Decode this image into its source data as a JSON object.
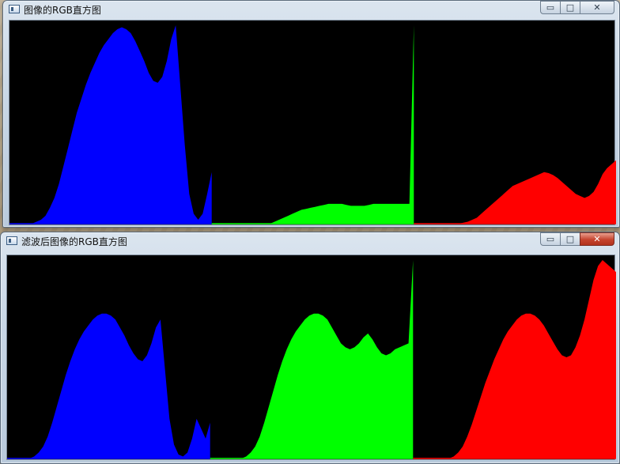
{
  "windows": [
    {
      "title": "图像的RGB直方图",
      "buttons": {
        "minimize": "▭",
        "maximize": "□",
        "close": "✕"
      }
    },
    {
      "title": "滤波后图像的RGB直方图",
      "buttons": {
        "minimize": "▭",
        "maximize": "□",
        "close": "✕"
      }
    }
  ],
  "colors": {
    "blue": "#0000ff",
    "green": "#00ff00",
    "red": "#ff0000",
    "background": "#000000"
  },
  "chart_data": [
    {
      "type": "area",
      "title": "",
      "series": [
        {
          "color": "#0000ff",
          "values": [
            0,
            0,
            0,
            0,
            0,
            0,
            0.01,
            0.02,
            0.04,
            0.08,
            0.13,
            0.2,
            0.29,
            0.38,
            0.47,
            0.56,
            0.63,
            0.7,
            0.76,
            0.81,
            0.86,
            0.9,
            0.93,
            0.96,
            0.98,
            0.99,
            0.98,
            0.96,
            0.92,
            0.87,
            0.82,
            0.76,
            0.72,
            0.71,
            0.74,
            0.82,
            0.93,
            1.0,
            0.7,
            0.4,
            0.15,
            0.05,
            0.02,
            0.05,
            0.15,
            0.26
          ]
        },
        {
          "color": "#00ff00",
          "values": [
            0,
            0,
            0,
            0,
            0,
            0,
            0,
            0,
            0,
            0,
            0,
            0,
            0,
            0,
            0.01,
            0.02,
            0.03,
            0.04,
            0.05,
            0.06,
            0.07,
            0.075,
            0.08,
            0.085,
            0.09,
            0.095,
            0.1,
            0.1,
            0.1,
            0.1,
            0.095,
            0.09,
            0.09,
            0.09,
            0.09,
            0.095,
            0.1,
            0.1,
            0.1,
            0.1,
            0.1,
            0.1,
            0.1,
            0.1,
            0.1,
            1.0
          ]
        },
        {
          "color": "#ff0000",
          "values": [
            0,
            0,
            0,
            0,
            0,
            0,
            0,
            0,
            0,
            0,
            0,
            0.005,
            0.01,
            0.02,
            0.03,
            0.05,
            0.07,
            0.09,
            0.11,
            0.13,
            0.15,
            0.17,
            0.19,
            0.2,
            0.21,
            0.22,
            0.23,
            0.24,
            0.25,
            0.26,
            0.255,
            0.245,
            0.23,
            0.21,
            0.19,
            0.17,
            0.15,
            0.14,
            0.13,
            0.14,
            0.16,
            0.2,
            0.25,
            0.28,
            0.3,
            0.32
          ]
        }
      ]
    },
    {
      "type": "area",
      "title": "",
      "series": [
        {
          "color": "#0000ff",
          "values": [
            0,
            0,
            0,
            0,
            0,
            0,
            0.01,
            0.03,
            0.06,
            0.11,
            0.18,
            0.26,
            0.34,
            0.42,
            0.49,
            0.55,
            0.6,
            0.64,
            0.67,
            0.7,
            0.72,
            0.73,
            0.73,
            0.72,
            0.7,
            0.66,
            0.62,
            0.57,
            0.53,
            0.5,
            0.49,
            0.52,
            0.58,
            0.66,
            0.7,
            0.45,
            0.2,
            0.07,
            0.02,
            0.01,
            0.03,
            0.1,
            0.2,
            0.15,
            0.1,
            0.18
          ]
        },
        {
          "color": "#00ff00",
          "values": [
            0,
            0,
            0,
            0,
            0,
            0,
            0,
            0,
            0.01,
            0.03,
            0.06,
            0.11,
            0.18,
            0.26,
            0.34,
            0.42,
            0.49,
            0.55,
            0.6,
            0.64,
            0.67,
            0.7,
            0.72,
            0.73,
            0.73,
            0.72,
            0.7,
            0.66,
            0.62,
            0.58,
            0.56,
            0.55,
            0.56,
            0.58,
            0.61,
            0.63,
            0.6,
            0.56,
            0.53,
            0.52,
            0.53,
            0.55,
            0.56,
            0.57,
            0.58,
            1.0
          ]
        },
        {
          "color": "#ff0000",
          "values": [
            0,
            0,
            0,
            0,
            0,
            0,
            0,
            0,
            0,
            0.01,
            0.03,
            0.06,
            0.11,
            0.17,
            0.24,
            0.31,
            0.38,
            0.44,
            0.5,
            0.55,
            0.6,
            0.64,
            0.67,
            0.7,
            0.72,
            0.73,
            0.73,
            0.72,
            0.7,
            0.67,
            0.63,
            0.59,
            0.55,
            0.52,
            0.51,
            0.52,
            0.56,
            0.62,
            0.7,
            0.8,
            0.9,
            0.97,
            1.0,
            0.98,
            0.96,
            0.94
          ]
        }
      ]
    }
  ]
}
